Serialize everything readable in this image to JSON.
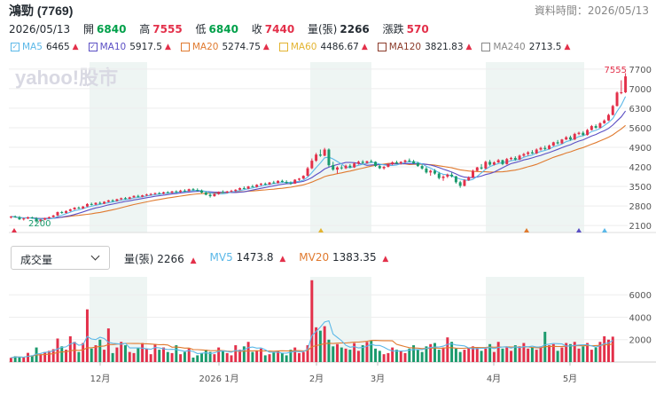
{
  "header": {
    "stock_name": "鴻勁 (7769)",
    "update_label": "資料時間：2026/05/13"
  },
  "quote": {
    "date": "2026/05/13",
    "open_label": "開",
    "open": "6840",
    "high_label": "高",
    "high": "7555",
    "low_label": "低",
    "low": "6840",
    "close_label": "收",
    "close": "7440",
    "volume_label": "量(張)",
    "volume": "2266",
    "change_label": "漲跌",
    "change": "570"
  },
  "ma_legend": [
    {
      "label": "MA5",
      "value": "6465",
      "color": "#5bb8e8",
      "checked": true,
      "arrow": "▲"
    },
    {
      "label": "MA10",
      "value": "5917.5",
      "color": "#5b4fc4",
      "checked": true,
      "arrow": "▲"
    },
    {
      "label": "MA20",
      "value": "5274.75",
      "color": "#e07a2f",
      "checked": false,
      "arrow": "▲"
    },
    {
      "label": "MA60",
      "value": "4486.67",
      "color": "#e3b431",
      "checked": false,
      "arrow": "▲"
    },
    {
      "label": "MA120",
      "value": "3821.83",
      "color": "#8b3b2a",
      "checked": false,
      "arrow": "▲"
    },
    {
      "label": "MA240",
      "value": "2713.5",
      "color": "#888888",
      "checked": false,
      "arrow": "▲"
    }
  ],
  "watermark": "yahoo!股市",
  "volume_selector": "成交量",
  "volume_legend": {
    "vol_label": "量(張)",
    "vol_value": "2266",
    "vol_arrow": "▲",
    "mv5_label": "MV5",
    "mv5_value": "1473.8",
    "mv5_arrow": "▲",
    "mv20_label": "MV20",
    "mv20_value": "1383.35",
    "mv20_arrow": "▲",
    "mv5_color": "#5bb8e8",
    "mv20_color": "#e07a2f"
  },
  "colors": {
    "up": "#e3304a",
    "down": "#1a9a6c",
    "band": "#eef5f3"
  },
  "chart_data": {
    "type": "candlestick",
    "price_ticks": [
      2100,
      2800,
      3500,
      4200,
      4900,
      5600,
      6300,
      7000,
      7700
    ],
    "max_label": "7555",
    "min_label": "2200",
    "volume_ticks": [
      2000,
      4000,
      6000
    ],
    "x_labels": [
      "12月",
      "2026 1月",
      "2月",
      "3月",
      "4月",
      "5月"
    ],
    "ohlc": [
      [
        2390,
        2440,
        2350,
        2420
      ],
      [
        2420,
        2460,
        2380,
        2400
      ],
      [
        2400,
        2440,
        2300,
        2320
      ],
      [
        2320,
        2380,
        2280,
        2350
      ],
      [
        2350,
        2420,
        2330,
        2390
      ],
      [
        2390,
        2420,
        2340,
        2360
      ],
      [
        2360,
        2400,
        2200,
        2250
      ],
      [
        2250,
        2330,
        2220,
        2310
      ],
      [
        2310,
        2380,
        2290,
        2360
      ],
      [
        2360,
        2420,
        2340,
        2400
      ],
      [
        2400,
        2480,
        2390,
        2460
      ],
      [
        2460,
        2600,
        2440,
        2580
      ],
      [
        2580,
        2620,
        2520,
        2550
      ],
      [
        2550,
        2640,
        2530,
        2620
      ],
      [
        2620,
        2700,
        2600,
        2680
      ],
      [
        2680,
        2760,
        2660,
        2740
      ],
      [
        2740,
        2780,
        2690,
        2710
      ],
      [
        2710,
        2800,
        2690,
        2780
      ],
      [
        2780,
        2900,
        2760,
        2870
      ],
      [
        2870,
        2920,
        2820,
        2850
      ],
      [
        2850,
        2930,
        2830,
        2910
      ],
      [
        2910,
        2960,
        2860,
        2880
      ],
      [
        2880,
        2970,
        2870,
        2950
      ],
      [
        2950,
        3020,
        2930,
        3000
      ],
      [
        3000,
        3040,
        2950,
        2980
      ],
      [
        2980,
        3060,
        2960,
        3040
      ],
      [
        3040,
        3100,
        3010,
        3080
      ],
      [
        3080,
        3120,
        3030,
        3050
      ],
      [
        3050,
        3130,
        3040,
        3110
      ],
      [
        3110,
        3180,
        3090,
        3160
      ],
      [
        3160,
        3200,
        3100,
        3130
      ],
      [
        3130,
        3200,
        3110,
        3180
      ],
      [
        3180,
        3240,
        3150,
        3210
      ],
      [
        3210,
        3260,
        3170,
        3230
      ],
      [
        3230,
        3280,
        3200,
        3260
      ],
      [
        3260,
        3300,
        3210,
        3240
      ],
      [
        3240,
        3310,
        3220,
        3290
      ],
      [
        3290,
        3330,
        3250,
        3270
      ],
      [
        3270,
        3340,
        3250,
        3320
      ],
      [
        3320,
        3360,
        3270,
        3300
      ],
      [
        3300,
        3380,
        3280,
        3350
      ],
      [
        3350,
        3400,
        3310,
        3330
      ],
      [
        3330,
        3420,
        3320,
        3400
      ],
      [
        3400,
        3440,
        3350,
        3370
      ],
      [
        3370,
        3430,
        3330,
        3350
      ],
      [
        3350,
        3390,
        3250,
        3280
      ],
      [
        3280,
        3320,
        3180,
        3200
      ],
      [
        3200,
        3260,
        3100,
        3150
      ],
      [
        3150,
        3250,
        3130,
        3230
      ],
      [
        3230,
        3320,
        3200,
        3300
      ],
      [
        3300,
        3360,
        3260,
        3280
      ],
      [
        3280,
        3340,
        3250,
        3320
      ],
      [
        3320,
        3380,
        3290,
        3340
      ],
      [
        3340,
        3400,
        3300,
        3380
      ],
      [
        3380,
        3460,
        3360,
        3440
      ],
      [
        3440,
        3500,
        3400,
        3420
      ],
      [
        3420,
        3520,
        3400,
        3500
      ],
      [
        3500,
        3560,
        3470,
        3480
      ],
      [
        3480,
        3580,
        3460,
        3560
      ],
      [
        3560,
        3620,
        3520,
        3600
      ],
      [
        3600,
        3640,
        3540,
        3570
      ],
      [
        3570,
        3660,
        3550,
        3640
      ],
      [
        3640,
        3700,
        3600,
        3620
      ],
      [
        3620,
        3720,
        3600,
        3700
      ],
      [
        3700,
        3740,
        3640,
        3660
      ],
      [
        3660,
        3720,
        3600,
        3620
      ],
      [
        3620,
        3680,
        3560,
        3600
      ],
      [
        3600,
        3760,
        3590,
        3740
      ],
      [
        3740,
        3800,
        3700,
        3780
      ],
      [
        3780,
        3900,
        3760,
        3880
      ],
      [
        3880,
        4200,
        3860,
        4150
      ],
      [
        4150,
        4500,
        4120,
        4420
      ],
      [
        4420,
        4700,
        4380,
        4640
      ],
      [
        4640,
        4820,
        4560,
        4600
      ],
      [
        4600,
        4880,
        4580,
        4820
      ],
      [
        4820,
        4860,
        4200,
        4260
      ],
      [
        4260,
        4380,
        4060,
        4100
      ],
      [
        4100,
        4220,
        3960,
        4180
      ],
      [
        4180,
        4260,
        4100,
        4150
      ],
      [
        4150,
        4280,
        4120,
        4240
      ],
      [
        4240,
        4300,
        4150,
        4180
      ],
      [
        4180,
        4360,
        4160,
        4320
      ],
      [
        4320,
        4420,
        4280,
        4380
      ],
      [
        4380,
        4440,
        4300,
        4340
      ],
      [
        4340,
        4420,
        4310,
        4400
      ],
      [
        4400,
        4460,
        4350,
        4380
      ],
      [
        4380,
        4400,
        4200,
        4230
      ],
      [
        4230,
        4280,
        4120,
        4150
      ],
      [
        4150,
        4230,
        4100,
        4200
      ],
      [
        4200,
        4330,
        4180,
        4300
      ],
      [
        4300,
        4400,
        4260,
        4360
      ],
      [
        4360,
        4420,
        4300,
        4320
      ],
      [
        4320,
        4400,
        4280,
        4380
      ],
      [
        4380,
        4460,
        4330,
        4430
      ],
      [
        4430,
        4500,
        4370,
        4400
      ],
      [
        4400,
        4450,
        4300,
        4330
      ],
      [
        4330,
        4380,
        4200,
        4230
      ],
      [
        4230,
        4280,
        4100,
        4140
      ],
      [
        4140,
        4200,
        3960,
        4000
      ],
      [
        4000,
        4100,
        3880,
        4060
      ],
      [
        4060,
        4120,
        3920,
        3960
      ],
      [
        3960,
        4020,
        3750,
        3800
      ],
      [
        3800,
        3900,
        3700,
        3850
      ],
      [
        3850,
        3960,
        3800,
        3920
      ],
      [
        3920,
        4000,
        3820,
        3860
      ],
      [
        3860,
        3880,
        3600,
        3650
      ],
      [
        3650,
        3700,
        3450,
        3520
      ],
      [
        3520,
        3760,
        3500,
        3720
      ],
      [
        3720,
        3860,
        3700,
        3820
      ],
      [
        3820,
        4100,
        3800,
        4060
      ],
      [
        4060,
        4200,
        4040,
        4180
      ],
      [
        4180,
        4300,
        4100,
        4140
      ],
      [
        4140,
        4420,
        4120,
        4380
      ],
      [
        4380,
        4450,
        4240,
        4280
      ],
      [
        4280,
        4400,
        4250,
        4360
      ],
      [
        4360,
        4480,
        4340,
        4440
      ],
      [
        4440,
        4460,
        4260,
        4300
      ],
      [
        4300,
        4520,
        4280,
        4480
      ],
      [
        4480,
        4560,
        4440,
        4520
      ],
      [
        4520,
        4580,
        4420,
        4460
      ],
      [
        4460,
        4640,
        4440,
        4600
      ],
      [
        4600,
        4700,
        4560,
        4660
      ],
      [
        4660,
        4760,
        4600,
        4720
      ],
      [
        4720,
        4800,
        4660,
        4680
      ],
      [
        4680,
        4860,
        4660,
        4820
      ],
      [
        4820,
        4920,
        4780,
        4880
      ],
      [
        4880,
        4960,
        4800,
        4840
      ],
      [
        4840,
        5000,
        4820,
        4960
      ],
      [
        4960,
        5100,
        4940,
        5080
      ],
      [
        5080,
        5160,
        5000,
        5040
      ],
      [
        5040,
        5200,
        5020,
        5180
      ],
      [
        5180,
        5300,
        5160,
        5260
      ],
      [
        5260,
        5320,
        5140,
        5180
      ],
      [
        5180,
        5420,
        5160,
        5380
      ],
      [
        5380,
        5460,
        5340,
        5420
      ],
      [
        5420,
        5480,
        5300,
        5340
      ],
      [
        5340,
        5560,
        5320,
        5520
      ],
      [
        5520,
        5700,
        5500,
        5660
      ],
      [
        5660,
        5720,
        5560,
        5600
      ],
      [
        5600,
        5800,
        5580,
        5760
      ],
      [
        5760,
        5900,
        5740,
        5860
      ],
      [
        5860,
        6100,
        5840,
        6060
      ],
      [
        6060,
        6420,
        6040,
        6380
      ],
      [
        6380,
        6900,
        6360,
        6860
      ],
      [
        6860,
        7300,
        6800,
        6870
      ],
      [
        6870,
        7555,
        6840,
        7440
      ]
    ],
    "volume": [
      380,
      520,
      450,
      400,
      820,
      600,
      1300,
      700,
      900,
      1000,
      1150,
      2100,
      1400,
      1100,
      2300,
      1800,
      900,
      1700,
      4700,
      1200,
      1500,
      2000,
      1100,
      3000,
      800,
      1300,
      1800,
      1500,
      900,
      800,
      1300,
      1700,
      1200,
      700,
      1600,
      1100,
      1300,
      900,
      800,
      1500,
      700,
      900,
      1200,
      400,
      600,
      800,
      1100,
      900,
      700,
      1300,
      1000,
      800,
      600,
      1500,
      1100,
      1400,
      1800,
      900,
      1000,
      1200,
      600,
      700,
      900,
      1000,
      800,
      600,
      1100,
      1300,
      800,
      900,
      1500,
      7300,
      3100,
      2800,
      3200,
      2000,
      1400,
      1600,
      1300,
      1200,
      1100,
      1700,
      1000,
      1500,
      1800,
      1900,
      1200,
      1000,
      700,
      800,
      1300,
      1100,
      1000,
      800,
      1200,
      1500,
      1100,
      900,
      1400,
      1600,
      1700,
      1100,
      1300,
      2200,
      1800,
      1200,
      900,
      1100,
      1300,
      1400,
      1300,
      1000,
      1200,
      1600,
      900,
      1800,
      1200,
      1300,
      1000,
      1500,
      1400,
      1700,
      1200,
      1300,
      1100,
      1400,
      2700,
      1500,
      1600,
      1000,
      1300,
      1700,
      1600,
      1800,
      1200,
      1400,
      1700,
      1100,
      1300,
      1800,
      2300,
      2000,
      2266
    ]
  }
}
